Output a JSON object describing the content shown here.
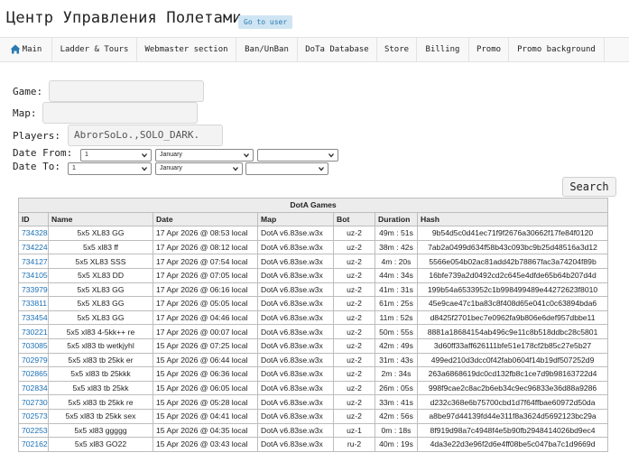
{
  "header": {
    "title": "Центр Управления Полетами",
    "goto_user": "Go to user"
  },
  "nav": [
    {
      "label": "Main",
      "icon": "home-icon"
    },
    {
      "label": "Ladder & Tours"
    },
    {
      "label": "Webmaster section"
    },
    {
      "label": "Ban/UnBan"
    },
    {
      "label": "DoTa Database"
    },
    {
      "label": "Store"
    },
    {
      "label": "Billing"
    },
    {
      "label": "Promo"
    },
    {
      "label": "Promo background"
    }
  ],
  "form": {
    "game_label": "Game:",
    "game_value": "",
    "map_label": "Map:",
    "map_value": "",
    "players_label": "Players:",
    "players_value": "AbrorSoLo.,SOLO_DARK.",
    "date_from_label": "Date From:",
    "date_from": {
      "day": "1",
      "month": "January",
      "year": ""
    },
    "date_to_label": "Date To:",
    "date_to": {
      "day": "1",
      "month": "January",
      "year": ""
    },
    "search_label": "Search"
  },
  "table": {
    "caption": "DotA Games",
    "columns": [
      "ID",
      "Name",
      "Date",
      "Map",
      "Bot",
      "Duration",
      "Hash"
    ],
    "rows": [
      [
        "734328",
        "5x5 XL83 GG",
        "17 Apr 2026 @ 08:53 local",
        "DotA v6.83se.w3x",
        "uz-2",
        "49m : 51s",
        "9b54d5c0d41ec71f9f2676a30662f17fe84f0120"
      ],
      [
        "734224",
        "5x5 xl83 ff",
        "17 Apr 2026 @ 08:12 local",
        "DotA v6.83se.w3x",
        "uz-2",
        "38m : 42s",
        "7ab2a0499d634f58b43c093bc9b25d48516a3d12"
      ],
      [
        "734127",
        "5x5 XL83 SSS",
        "17 Apr 2026 @ 07:54 local",
        "DotA v6.83se.w3x",
        "uz-2",
        "4m : 20s",
        "5566e054b02ac81add42b78867fac3a74204f89b"
      ],
      [
        "734105",
        "5x5 XL83 DD",
        "17 Apr 2026 @ 07:05 local",
        "DotA v6.83se.w3x",
        "uz-2",
        "44m : 34s",
        "16bfe739a2d0492cd2c645e4dfde65b64b207d4d"
      ],
      [
        "733979",
        "5x5 XL83 GG",
        "17 Apr 2026 @ 06:16 local",
        "DotA v6.83se.w3x",
        "uz-2",
        "41m : 31s",
        "199b54a6533952c1b998499489e44272623f8010"
      ],
      [
        "733811",
        "5x5 XL83 GG",
        "17 Apr 2026 @ 05:05 local",
        "DotA v6.83se.w3x",
        "uz-2",
        "61m : 25s",
        "45e9cae47c1ba83c8f408d65e041c0c63894bda6"
      ],
      [
        "733454",
        "5x5 XL83 GG",
        "17 Apr 2026 @ 04:46 local",
        "DotA v6.83se.w3x",
        "uz-2",
        "11m : 52s",
        "d8425f2701bec7e0962fa9b806e6def957dbbe11"
      ],
      [
        "730221",
        "5x5 xl83 4-5kk++ re",
        "17 Apr 2026 @ 00:07 local",
        "DotA v6.83se.w3x",
        "uz-2",
        "50m : 55s",
        "8881a18684154ab496c9e11c8b518ddbc28c5801"
      ],
      [
        "703085",
        "5x5 xl83 tb wetkjyhl",
        "15 Apr 2026 @ 07:25 local",
        "DotA v6.83se.w3x",
        "uz-2",
        "42m : 49s",
        "3d60ff33aff626111bfe51e178cf2b85c27e5b27"
      ],
      [
        "702979",
        "5x5 xl83 tb 25kk er",
        "15 Apr 2026 @ 06:44 local",
        "DotA v6.83se.w3x",
        "uz-2",
        "31m : 43s",
        "499ed210d3dcc0f42fab0604f14b19df507252d9"
      ],
      [
        "702865",
        "5x5 xl83 tb 25kkk",
        "15 Apr 2026 @ 06:36 local",
        "DotA v6.83se.w3x",
        "uz-2",
        "2m : 34s",
        "263a6868619dc0cd132fb8c1ce7d9b98163722d4"
      ],
      [
        "702834",
        "5x5 xl83 tb 25kk",
        "15 Apr 2026 @ 06:05 local",
        "DotA v6.83se.w3x",
        "uz-2",
        "26m : 05s",
        "998f9cae2c8ac2b6eb34c9ec96833e36d88a9286"
      ],
      [
        "702730",
        "5x5 xl83 tb 25kk re",
        "15 Apr 2026 @ 05:28 local",
        "DotA v6.83se.w3x",
        "uz-2",
        "33m : 41s",
        "d232c368e6b75700cbd1d7f64ffbae60972d50da"
      ],
      [
        "702573",
        "5x5 xl83 tb 25kk sex",
        "15 Apr 2026 @ 04:41 local",
        "DotA v6.83se.w3x",
        "uz-2",
        "42m : 56s",
        "a8be97d44139fd44e311f8a3624d5692123bc29a"
      ],
      [
        "702253",
        "5x5 xl83 ggggg",
        "15 Apr 2026 @ 04:35 local",
        "DotA v6.83se.w3x",
        "uz-1",
        "0m : 18s",
        "8f919d98a7c4948f4e5b90fb2948414026bd9ec4"
      ],
      [
        "702162",
        "5x5 xl83 GO22",
        "15 Apr 2026 @ 03:43 local",
        "DotA v6.83se.w3x",
        "ru-2",
        "40m : 19s",
        "4da3e22d3e96f2d6e4ff08be5c047ba7c1d9669d"
      ]
    ]
  },
  "colors": {
    "link": "#1a6fb5",
    "nav_icon": "#2a7ab0",
    "goto_bg": "#cfe5f3"
  }
}
